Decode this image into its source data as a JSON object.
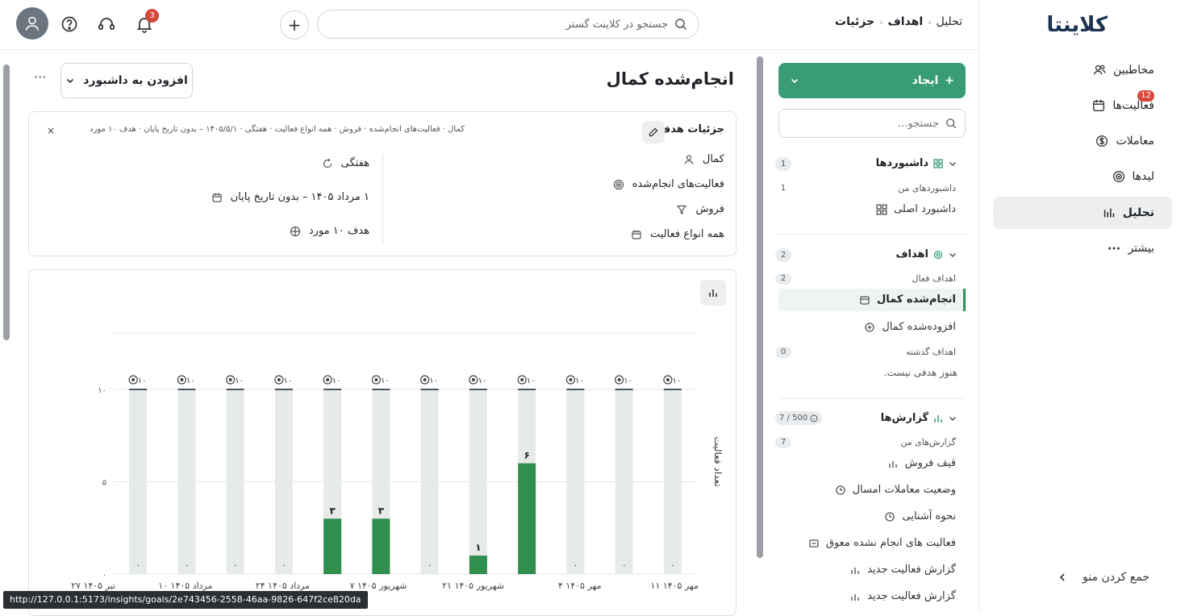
{
  "app": {
    "brand": "کلاینتا",
    "nav": [
      {
        "label": "مخاطبین",
        "icon": "users-icon"
      },
      {
        "label": "فعالیت‌ها",
        "icon": "calendar-icon",
        "badge": "12"
      },
      {
        "label": "معاملات",
        "icon": "dollar-icon"
      },
      {
        "label": "لیدها",
        "icon": "target-icon"
      },
      {
        "label": "تحلیل",
        "icon": "analytics-icon",
        "active": true
      },
      {
        "label": "بیشتر",
        "icon": "more-icon"
      }
    ],
    "collapse_label": "جمع کردن منو"
  },
  "topbar": {
    "breadcrumb": [
      "تحلیل",
      "اهداف",
      "جزئیات"
    ],
    "search_placeholder": "جستجو در کلاینت گستر",
    "notifications_count": "3"
  },
  "sidebar": {
    "create_label": "ایجاد",
    "search_placeholder": "جستجو...",
    "dashboards": {
      "title": "داشبوردها",
      "count": "1",
      "sub_title": "داشبوردهای من",
      "sub_count": "1",
      "items": [
        "داشبورد اصلی"
      ]
    },
    "goals": {
      "title": "اهداف",
      "count": "2",
      "active_title": "اهداف فعال",
      "active_count": "2",
      "items": [
        "انجام‌شده کمال",
        "افزوده‌شده کمال"
      ],
      "past_title": "اهداف گذشته",
      "past_count": "0",
      "empty_text": "هنوز هدفی نیست."
    },
    "reports": {
      "title": "گزارش‌ها",
      "quota": "7 / 500",
      "sub_title": "گزارش‌های من",
      "sub_count": "7",
      "items": [
        "قیف فروش",
        "وضعیت معاملات امسال",
        "نحوه آشنایی",
        "فعالیت های انجام نشده معوق",
        "گزارش فعالیت جدید",
        "گزارش فعالیت جدید"
      ]
    }
  },
  "page": {
    "title": "انجام‌شده کمال",
    "add_to_dashboard": "افزودن به داشبورد",
    "more": "···",
    "details": {
      "title": "جزئیات هدف",
      "summary": "کمال · فعالیت‌های انجام‌شده · فروش · همه انواع فعالیت · هفتگی · ۱۴۰۵/۵/۱ – بدون تاریخ پایان · هدف ۱۰ مورد",
      "close": "×",
      "right_rows": [
        "کمال",
        "فعالیت‌های انجام‌شده",
        "فروش",
        "همه انواع فعالیت"
      ],
      "left_rows": [
        "هفتگی",
        "۱ مرداد ۱۴۰۵ – بدون تاریخ پایان",
        "هدف ۱۰ مورد"
      ]
    }
  },
  "chart_data": {
    "type": "bar",
    "ylabel": "تعداد فعالیت",
    "ylim": [
      0,
      10
    ],
    "yticks": [
      "۰",
      "۵",
      "۱۰"
    ],
    "goal": 10,
    "goal_label": "۱۰",
    "categories": [
      "مهر ۱۴۰۵ ۱۱",
      "",
      "مهر ۱۴۰۵ ۴",
      "",
      "شهریور ۱۴۰۵ ۲۱",
      "",
      "شهریور ۱۴۰۵ ۷",
      "",
      "مرداد ۱۴۰۵ ۲۴",
      "",
      "مرداد ۱۴۰۵ ۱۰",
      "",
      "تیر ۱۴۰۵ ۲۷"
    ],
    "values": [
      0,
      0,
      0,
      6,
      1,
      0,
      3,
      3,
      0,
      0,
      0,
      0
    ],
    "value_labels": [
      "۰",
      "۰",
      "۰",
      "۶",
      "۱",
      "۰",
      "۳",
      "۳",
      "۰",
      "۰",
      "۰",
      "۰"
    ],
    "colors": {
      "bar": "#2f8f4e",
      "track": "#e6ebe8",
      "goal_line": "#4b5563"
    }
  },
  "status_url": "http://127.0.0.1:5173/insights/goals/2e743456-2558-46aa-9826-647f2ce820da"
}
